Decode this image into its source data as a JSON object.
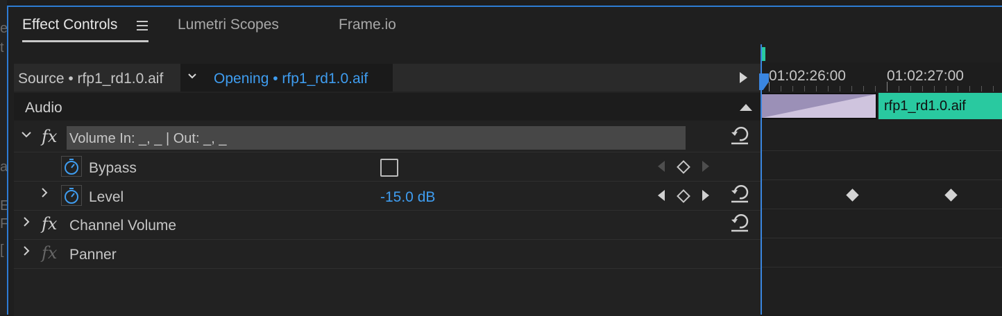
{
  "tabs": {
    "effect_controls": "Effect Controls",
    "lumetri_scopes": "Lumetri Scopes",
    "frame_io": "Frame.io"
  },
  "source_bar": {
    "source": "Source • rfp1_rd1.0.aif",
    "sequence_clip": "Opening • rfp1_rd1.0.aif"
  },
  "section": {
    "audio": "Audio"
  },
  "effects": {
    "volume": {
      "name": "Volume In: _, _ | Out: _, _",
      "bypass_label": "Bypass",
      "bypass_checked": false,
      "level_label": "Level",
      "level_value": "-15.0 dB"
    },
    "channel_volume": "Channel Volume",
    "panner": "Panner"
  },
  "timeline": {
    "time_1": "01:02:26:00",
    "time_2": "01:02:27:00",
    "clip_name": "rfp1_rd1.0.aif"
  },
  "left_gutter_glyphs": [
    "e",
    "t",
    "a",
    "E",
    "F",
    "["
  ],
  "colors": {
    "accent_blue": "#3f9df0",
    "clip_green": "#29c9a0",
    "clip_lavender": "#cfc4de",
    "panel_border": "#2d7cd4"
  }
}
